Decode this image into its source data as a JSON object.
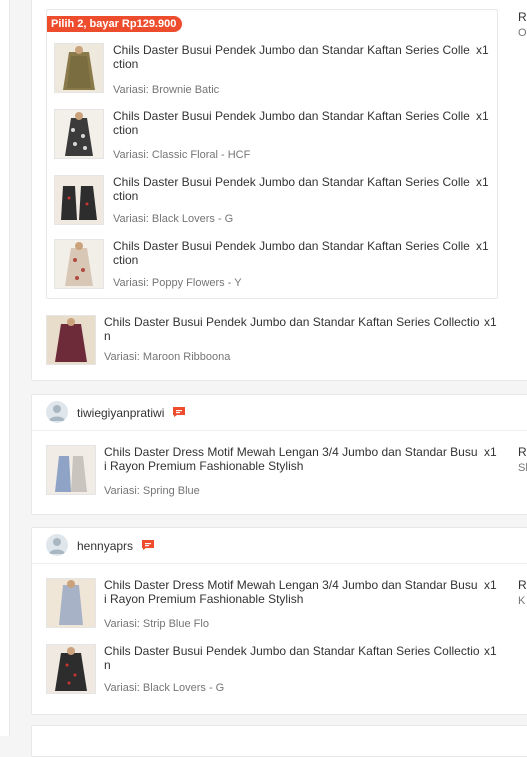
{
  "colors": {
    "accent": "#ee4d2d",
    "muted": "#757575",
    "border": "#e8e8e8"
  },
  "order1": {
    "promo_label": "Pilih 2, bayar Rp129.900",
    "right_title": "R",
    "right_sub": "O",
    "bundle_items": [
      {
        "title": "Chils Daster Busui Pendek Jumbo dan Standar Kaftan Series Collection",
        "variant": "Variasi: Brownie Batic",
        "qty": "x1"
      },
      {
        "title": "Chils Daster Busui Pendek Jumbo dan Standar Kaftan Series Collection",
        "variant": "Variasi: Classic Floral - HCF",
        "qty": "x1"
      },
      {
        "title": "Chils Daster Busui Pendek Jumbo dan Standar Kaftan Series Collection",
        "variant": "Variasi: Black Lovers - G",
        "qty": "x1"
      },
      {
        "title": "Chils Daster Busui Pendek Jumbo dan Standar Kaftan Series Collection",
        "variant": "Variasi: Poppy Flowers - Y",
        "qty": "x1"
      }
    ],
    "extra_item": {
      "title": "Chils Daster Busui Pendek Jumbo dan Standar Kaftan Series Collection",
      "variant": "Variasi: Maroon Ribboona",
      "qty": "x1"
    }
  },
  "order2": {
    "shop_name": "tiwiegiyanpratiwi",
    "right_title": "R",
    "right_sub": "Sl",
    "items": [
      {
        "title": "Chils Daster Dress Motif Mewah Lengan 3/4 Jumbo dan Standar Busui Rayon Premium Fashionable Stylish",
        "variant": "Variasi: Spring Blue",
        "qty": "x1"
      }
    ]
  },
  "order3": {
    "shop_name": "hennyaprs",
    "right_title": "R",
    "right_sub": "K",
    "items": [
      {
        "title": "Chils Daster Dress Motif Mewah Lengan 3/4 Jumbo dan Standar Busui Rayon Premium Fashionable Stylish",
        "variant": "Variasi: Strip Blue Flo",
        "qty": "x1"
      },
      {
        "title": "Chils Daster Busui Pendek Jumbo dan Standar Kaftan Series Collection",
        "variant": "Variasi: Black Lovers - G",
        "qty": "x1"
      }
    ]
  },
  "icons": {
    "avatar": "user-avatar-icon",
    "chat": "chat-bubble-icon"
  }
}
